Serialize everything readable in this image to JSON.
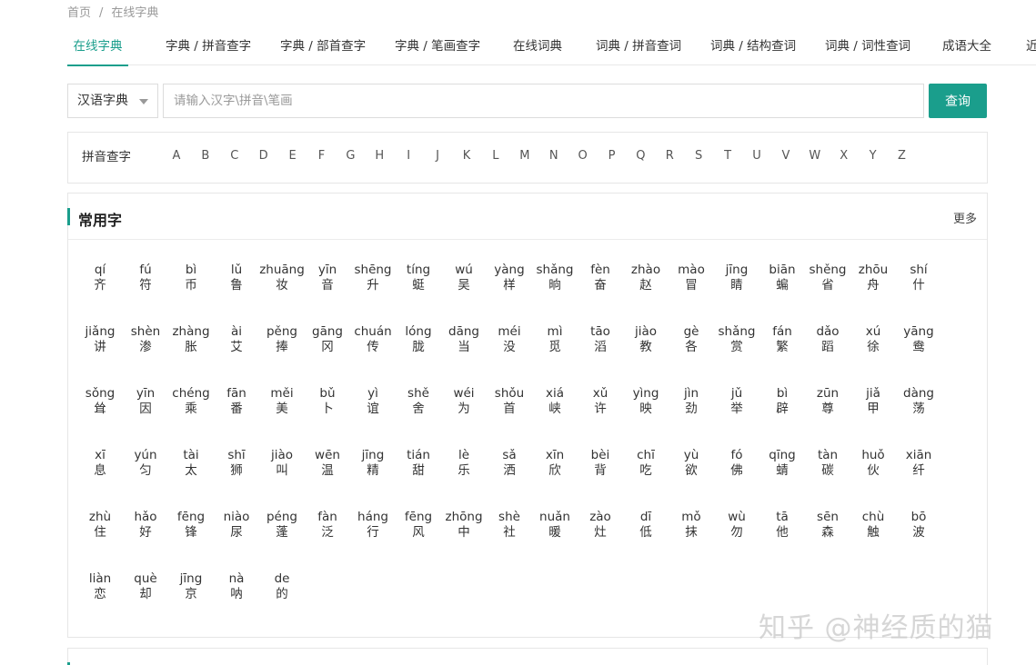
{
  "breadcrumb": {
    "home": "首页",
    "separator": "/",
    "current": "在线字典"
  },
  "tabs": [
    {
      "label": "在线字典"
    },
    {
      "label": "字典 / 拼音查字"
    },
    {
      "label": "字典 / 部首查字"
    },
    {
      "label": "字典 / 笔画查字"
    },
    {
      "label": "在线词典"
    },
    {
      "label": "词典 / 拼音查词"
    },
    {
      "label": "词典 / 结构查词"
    },
    {
      "label": "词典 / 词性查词"
    },
    {
      "label": "成语大全"
    },
    {
      "label": "近"
    }
  ],
  "search": {
    "select_value": "汉语字典",
    "placeholder": "请输入汉字\\拼音\\笔画",
    "button_label": "查询"
  },
  "pinyin_index": {
    "label": "拼音查字",
    "letters": [
      "A",
      "B",
      "C",
      "D",
      "E",
      "F",
      "G",
      "H",
      "I",
      "J",
      "K",
      "L",
      "M",
      "N",
      "O",
      "P",
      "Q",
      "R",
      "S",
      "T",
      "U",
      "V",
      "W",
      "X",
      "Y",
      "Z"
    ]
  },
  "common_chars": {
    "title": "常用字",
    "more": "更多",
    "items": [
      {
        "py": "qí",
        "hz": "齐"
      },
      {
        "py": "fú",
        "hz": "符"
      },
      {
        "py": "bì",
        "hz": "币"
      },
      {
        "py": "lǔ",
        "hz": "鲁"
      },
      {
        "py": "zhuāng",
        "hz": "妆"
      },
      {
        "py": "yīn",
        "hz": "音"
      },
      {
        "py": "shēng",
        "hz": "升"
      },
      {
        "py": "tíng",
        "hz": "蜓"
      },
      {
        "py": "wú",
        "hz": "吴"
      },
      {
        "py": "yàng",
        "hz": "样"
      },
      {
        "py": "shǎng",
        "hz": "晌"
      },
      {
        "py": "fèn",
        "hz": "奋"
      },
      {
        "py": "zhào",
        "hz": "赵"
      },
      {
        "py": "mào",
        "hz": "冒"
      },
      {
        "py": "jīng",
        "hz": "睛"
      },
      {
        "py": "biān",
        "hz": "蝙"
      },
      {
        "py": "shěng",
        "hz": "省"
      },
      {
        "py": "zhōu",
        "hz": "舟"
      },
      {
        "py": "shí",
        "hz": "什"
      },
      {
        "py": "jiǎng",
        "hz": "讲"
      },
      {
        "py": "shèn",
        "hz": "渗"
      },
      {
        "py": "zhàng",
        "hz": "胀"
      },
      {
        "py": "ài",
        "hz": "艾"
      },
      {
        "py": "pěng",
        "hz": "捧"
      },
      {
        "py": "gāng",
        "hz": "冈"
      },
      {
        "py": "chuán",
        "hz": "传"
      },
      {
        "py": "lóng",
        "hz": "胧"
      },
      {
        "py": "dāng",
        "hz": "当"
      },
      {
        "py": "méi",
        "hz": "没"
      },
      {
        "py": "mì",
        "hz": "觅"
      },
      {
        "py": "tāo",
        "hz": "滔"
      },
      {
        "py": "jiào",
        "hz": "教"
      },
      {
        "py": "gè",
        "hz": "各"
      },
      {
        "py": "shǎng",
        "hz": "赏"
      },
      {
        "py": "fán",
        "hz": "繁"
      },
      {
        "py": "dǎo",
        "hz": "蹈"
      },
      {
        "py": "xú",
        "hz": "徐"
      },
      {
        "py": "yāng",
        "hz": "鸯"
      },
      {
        "py": "sǒng",
        "hz": "耸"
      },
      {
        "py": "yīn",
        "hz": "因"
      },
      {
        "py": "chéng",
        "hz": "乘"
      },
      {
        "py": "fān",
        "hz": "番"
      },
      {
        "py": "měi",
        "hz": "美"
      },
      {
        "py": "bǔ",
        "hz": "卜"
      },
      {
        "py": "yì",
        "hz": "谊"
      },
      {
        "py": "shě",
        "hz": "舍"
      },
      {
        "py": "wéi",
        "hz": "为"
      },
      {
        "py": "shǒu",
        "hz": "首"
      },
      {
        "py": "xiá",
        "hz": "峡"
      },
      {
        "py": "xǔ",
        "hz": "许"
      },
      {
        "py": "yìng",
        "hz": "映"
      },
      {
        "py": "jìn",
        "hz": "劲"
      },
      {
        "py": "jǔ",
        "hz": "举"
      },
      {
        "py": "bì",
        "hz": "辟"
      },
      {
        "py": "zūn",
        "hz": "尊"
      },
      {
        "py": "jiǎ",
        "hz": "甲"
      },
      {
        "py": "dàng",
        "hz": "荡"
      },
      {
        "py": "xī",
        "hz": "息"
      },
      {
        "py": "yún",
        "hz": "匀"
      },
      {
        "py": "tài",
        "hz": "太"
      },
      {
        "py": "shī",
        "hz": "狮"
      },
      {
        "py": "jiào",
        "hz": "叫"
      },
      {
        "py": "wēn",
        "hz": "温"
      },
      {
        "py": "jīng",
        "hz": "精"
      },
      {
        "py": "tián",
        "hz": "甜"
      },
      {
        "py": "lè",
        "hz": "乐"
      },
      {
        "py": "sǎ",
        "hz": "洒"
      },
      {
        "py": "xīn",
        "hz": "欣"
      },
      {
        "py": "bèi",
        "hz": "背"
      },
      {
        "py": "chī",
        "hz": "吃"
      },
      {
        "py": "yù",
        "hz": "欲"
      },
      {
        "py": "fó",
        "hz": "佛"
      },
      {
        "py": "qīng",
        "hz": "蜻"
      },
      {
        "py": "tàn",
        "hz": "碳"
      },
      {
        "py": "huǒ",
        "hz": "伙"
      },
      {
        "py": "xiān",
        "hz": "纤"
      },
      {
        "py": "zhù",
        "hz": "住"
      },
      {
        "py": "hǎo",
        "hz": "好"
      },
      {
        "py": "fēng",
        "hz": "锋"
      },
      {
        "py": "niào",
        "hz": "尿"
      },
      {
        "py": "péng",
        "hz": "蓬"
      },
      {
        "py": "fàn",
        "hz": "泛"
      },
      {
        "py": "háng",
        "hz": "行"
      },
      {
        "py": "fēng",
        "hz": "风"
      },
      {
        "py": "zhōng",
        "hz": "中"
      },
      {
        "py": "shè",
        "hz": "社"
      },
      {
        "py": "nuǎn",
        "hz": "暖"
      },
      {
        "py": "zào",
        "hz": "灶"
      },
      {
        "py": "dī",
        "hz": "低"
      },
      {
        "py": "mǒ",
        "hz": "抹"
      },
      {
        "py": "wù",
        "hz": "勿"
      },
      {
        "py": "tā",
        "hz": "他"
      },
      {
        "py": "sēn",
        "hz": "森"
      },
      {
        "py": "chù",
        "hz": "触"
      },
      {
        "py": "bō",
        "hz": "波"
      },
      {
        "py": "liàn",
        "hz": "恋"
      },
      {
        "py": "què",
        "hz": "却"
      },
      {
        "py": "jīng",
        "hz": "京"
      },
      {
        "py": "nà",
        "hz": "呐"
      },
      {
        "py": "de",
        "hz": "的"
      }
    ]
  },
  "watermark": "知乎 @神经质的猫",
  "colors": {
    "accent": "#1a9e8c",
    "border": "#e6e6e6",
    "muted": "#999999"
  }
}
